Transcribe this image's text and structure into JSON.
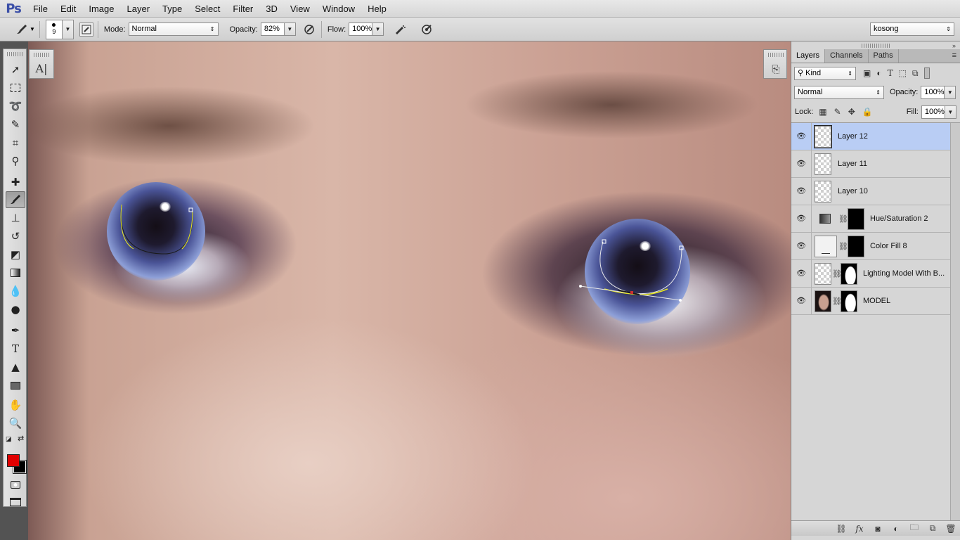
{
  "app": {
    "logo": "Ps"
  },
  "menu": [
    "File",
    "Edit",
    "Image",
    "Layer",
    "Type",
    "Select",
    "Filter",
    "3D",
    "View",
    "Window",
    "Help"
  ],
  "options_bar": {
    "brush_size": "9",
    "mode_label": "Mode:",
    "mode_value": "Normal",
    "opacity_label": "Opacity:",
    "opacity_value": "82%",
    "flow_label": "Flow:",
    "flow_value": "100%",
    "workspace": "kosong"
  },
  "toolbox": {
    "tools": [
      "move-tool",
      "marquee-tool",
      "lasso-tool",
      "quick-selection-tool",
      "crop-tool",
      "eyedropper-tool",
      "spot-healing-tool",
      "brush-tool",
      "clone-stamp-tool",
      "history-brush-tool",
      "eraser-tool",
      "gradient-tool",
      "blur-tool",
      "dodge-tool",
      "pen-tool",
      "type-tool",
      "path-selection-tool",
      "rectangle-tool",
      "hand-tool",
      "zoom-tool"
    ],
    "active_tool": "brush-tool",
    "foreground_color": "#e00000",
    "background_color": "#000000"
  },
  "layers_panel": {
    "tabs": [
      "Layers",
      "Channels",
      "Paths"
    ],
    "active_tab": "Layers",
    "filter_kind": "Kind",
    "blend_mode": "Normal",
    "opacity_label": "Opacity:",
    "opacity_value": "100%",
    "lock_label": "Lock:",
    "fill_label": "Fill:",
    "fill_value": "100%",
    "layers": [
      {
        "name": "Layer 12",
        "selected": true,
        "visible": true,
        "type": "pixel"
      },
      {
        "name": "Layer 11",
        "selected": false,
        "visible": true,
        "type": "pixel"
      },
      {
        "name": "Layer 10",
        "selected": false,
        "visible": true,
        "type": "pixel"
      },
      {
        "name": "Hue/Saturation 2",
        "selected": false,
        "visible": true,
        "type": "adjustment"
      },
      {
        "name": "Color Fill 8",
        "selected": false,
        "visible": true,
        "type": "fill"
      },
      {
        "name": "Lighting Model With B...",
        "selected": false,
        "visible": true,
        "type": "masked"
      },
      {
        "name": "MODEL",
        "selected": false,
        "visible": true,
        "type": "masked"
      }
    ]
  },
  "colors": {
    "selection": "#b9cdf4",
    "accent": "#3b4fa8"
  }
}
